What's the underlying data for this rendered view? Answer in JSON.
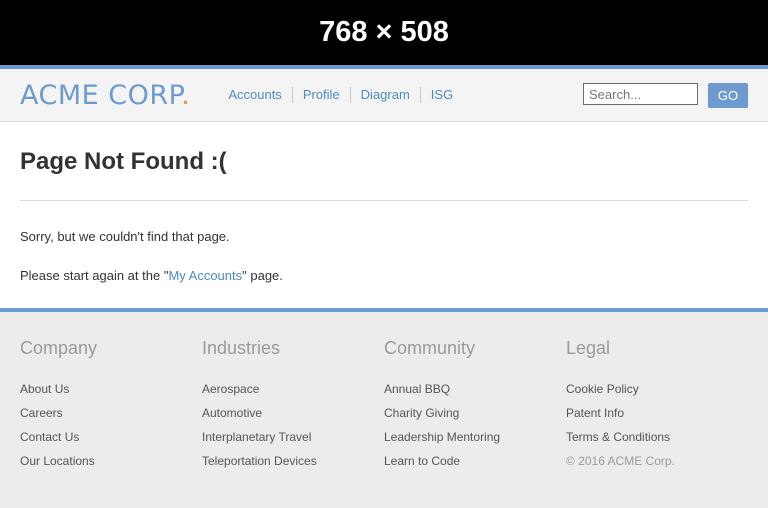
{
  "banner": {
    "text": "768 × 508"
  },
  "header": {
    "logo_text": "ACME CORP",
    "logo_dot": ".",
    "nav": [
      "Accounts",
      "Profile",
      "Diagram",
      "ISG"
    ],
    "search_placeholder": "Search...",
    "go_label": "GO"
  },
  "main": {
    "title": "Page Not Found :(",
    "line1": "Sorry, but we couldn't find that page.",
    "line2_prefix": "Please start again at the \"",
    "line2_link": "My Accounts",
    "line2_suffix": "\" page."
  },
  "footer": {
    "columns": [
      {
        "title": "Company",
        "links": [
          "About Us",
          "Careers",
          "Contact Us",
          "Our Locations"
        ]
      },
      {
        "title": "Industries",
        "links": [
          "Aerospace",
          "Automotive",
          "Interplanetary Travel",
          "Teleportation Devices"
        ]
      },
      {
        "title": "Community",
        "links": [
          "Annual BBQ",
          "Charity Giving",
          "Leadership Mentoring",
          "Learn to Code"
        ]
      },
      {
        "title": "Legal",
        "links": [
          "Cookie Policy",
          "Patent Info",
          "Terms & Conditions"
        ],
        "copyright": "© 2016 ACME Corp."
      }
    ]
  },
  "colors": {
    "accent": "#6d9bcf",
    "link": "#4f8ac6",
    "logo_dot": "#e8963a"
  }
}
